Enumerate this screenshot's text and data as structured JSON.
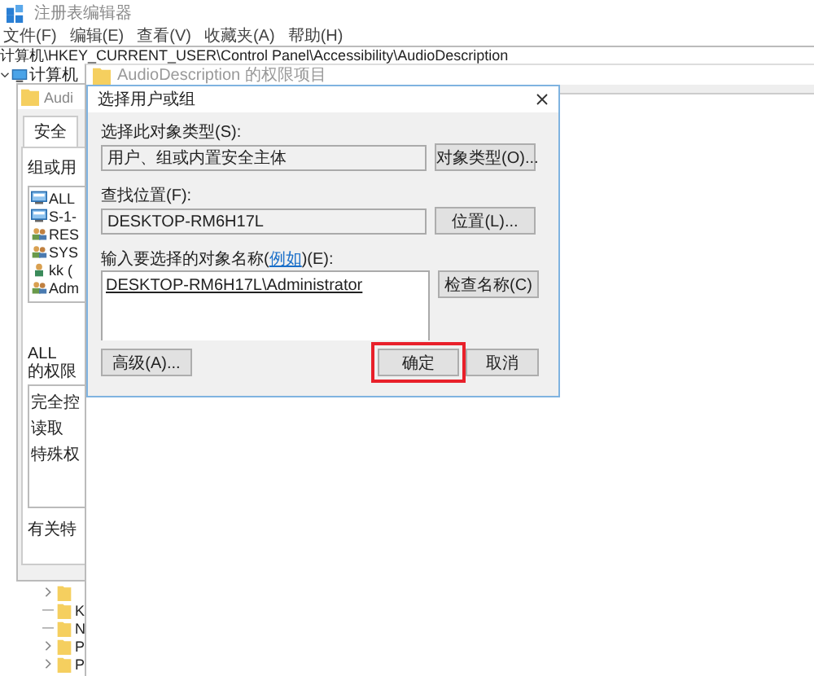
{
  "registry_window": {
    "title": "注册表编辑器",
    "menu": [
      "文件(F)",
      "编辑(E)",
      "查看(V)",
      "收藏夹(A)",
      "帮助(H)"
    ],
    "address": "计算机\\HKEY_CURRENT_USER\\Control Panel\\Accessibility\\AudioDescription",
    "tree": {
      "label": "计算机",
      "expanded": true,
      "children": [
        {
          "has_children": true
        },
        {
          "label": "K",
          "has_children": false
        },
        {
          "label": "N",
          "has_children": false
        },
        {
          "label": "P",
          "has_children": true
        },
        {
          "label": "P",
          "has_children": true
        }
      ]
    }
  },
  "permissions_dialog": {
    "title": "Audi",
    "tabs": [
      {
        "label": "安全",
        "selected": true
      }
    ],
    "groups_label": "组或用",
    "users": [
      {
        "name": "ALL",
        "kind": "package"
      },
      {
        "name": "S-1-",
        "kind": "package"
      },
      {
        "name": "RES",
        "kind": "group"
      },
      {
        "name": "SYS",
        "kind": "group"
      },
      {
        "name": "kk (",
        "kind": "user"
      },
      {
        "name": "Adm",
        "kind": "group"
      }
    ],
    "permissions_for": [
      "ALL",
      "的权限"
    ],
    "permissions": [
      "完全控",
      "读取",
      "特殊权"
    ],
    "note": "有关特"
  },
  "entry_window": {
    "title": "AudioDescription 的权限项目"
  },
  "select_dialog": {
    "title": "选择用户或组",
    "object_type_label": "选择此对象类型(S):",
    "object_type": "用户、组或内置安全主体",
    "object_type_button": "对象类型(O)...",
    "location_label": "查找位置(F):",
    "location": "DESKTOP-RM6H17L",
    "location_button": "位置(L)...",
    "names_label_before": "输入要选择的对象名称(",
    "names_label_link": "例如",
    "names_label_after": ")(E):",
    "names_value": "DESKTOP-RM6H17L\\Administrator",
    "check_button": "检查名称(C)",
    "advanced_button": "高级(A)...",
    "ok_button": {
      "label": "确定",
      "highlighted": true
    },
    "cancel_button": "取消"
  }
}
